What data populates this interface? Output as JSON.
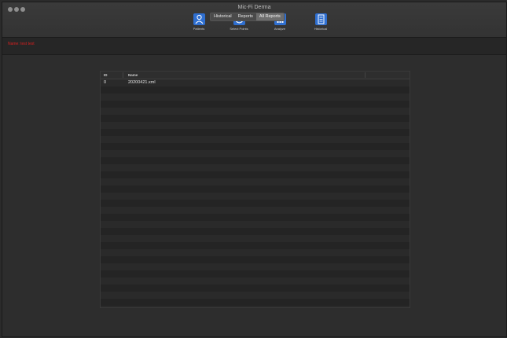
{
  "window": {
    "title": "Mic-Fi Derma"
  },
  "toolbar": {
    "items": [
      {
        "label": "Patients",
        "icon": "person-icon"
      },
      {
        "label": "Select Points",
        "icon": "target-icon"
      },
      {
        "label": "Analyze",
        "icon": "bar-chart-icon"
      },
      {
        "label": "Historical",
        "icon": "document-list-icon"
      }
    ]
  },
  "patient": {
    "label": "Name: test test"
  },
  "tabs": [
    {
      "label": "Historical",
      "selected": false
    },
    {
      "label": "Reports",
      "selected": false
    },
    {
      "label": "All Reports",
      "selected": true
    }
  ],
  "table": {
    "columns": [
      "ID",
      "Name"
    ],
    "rows": [
      {
        "id": "0",
        "name": "20200421.xml"
      }
    ]
  },
  "colors": {
    "accent": "#2f6fd0",
    "patient_label": "#d82020"
  }
}
